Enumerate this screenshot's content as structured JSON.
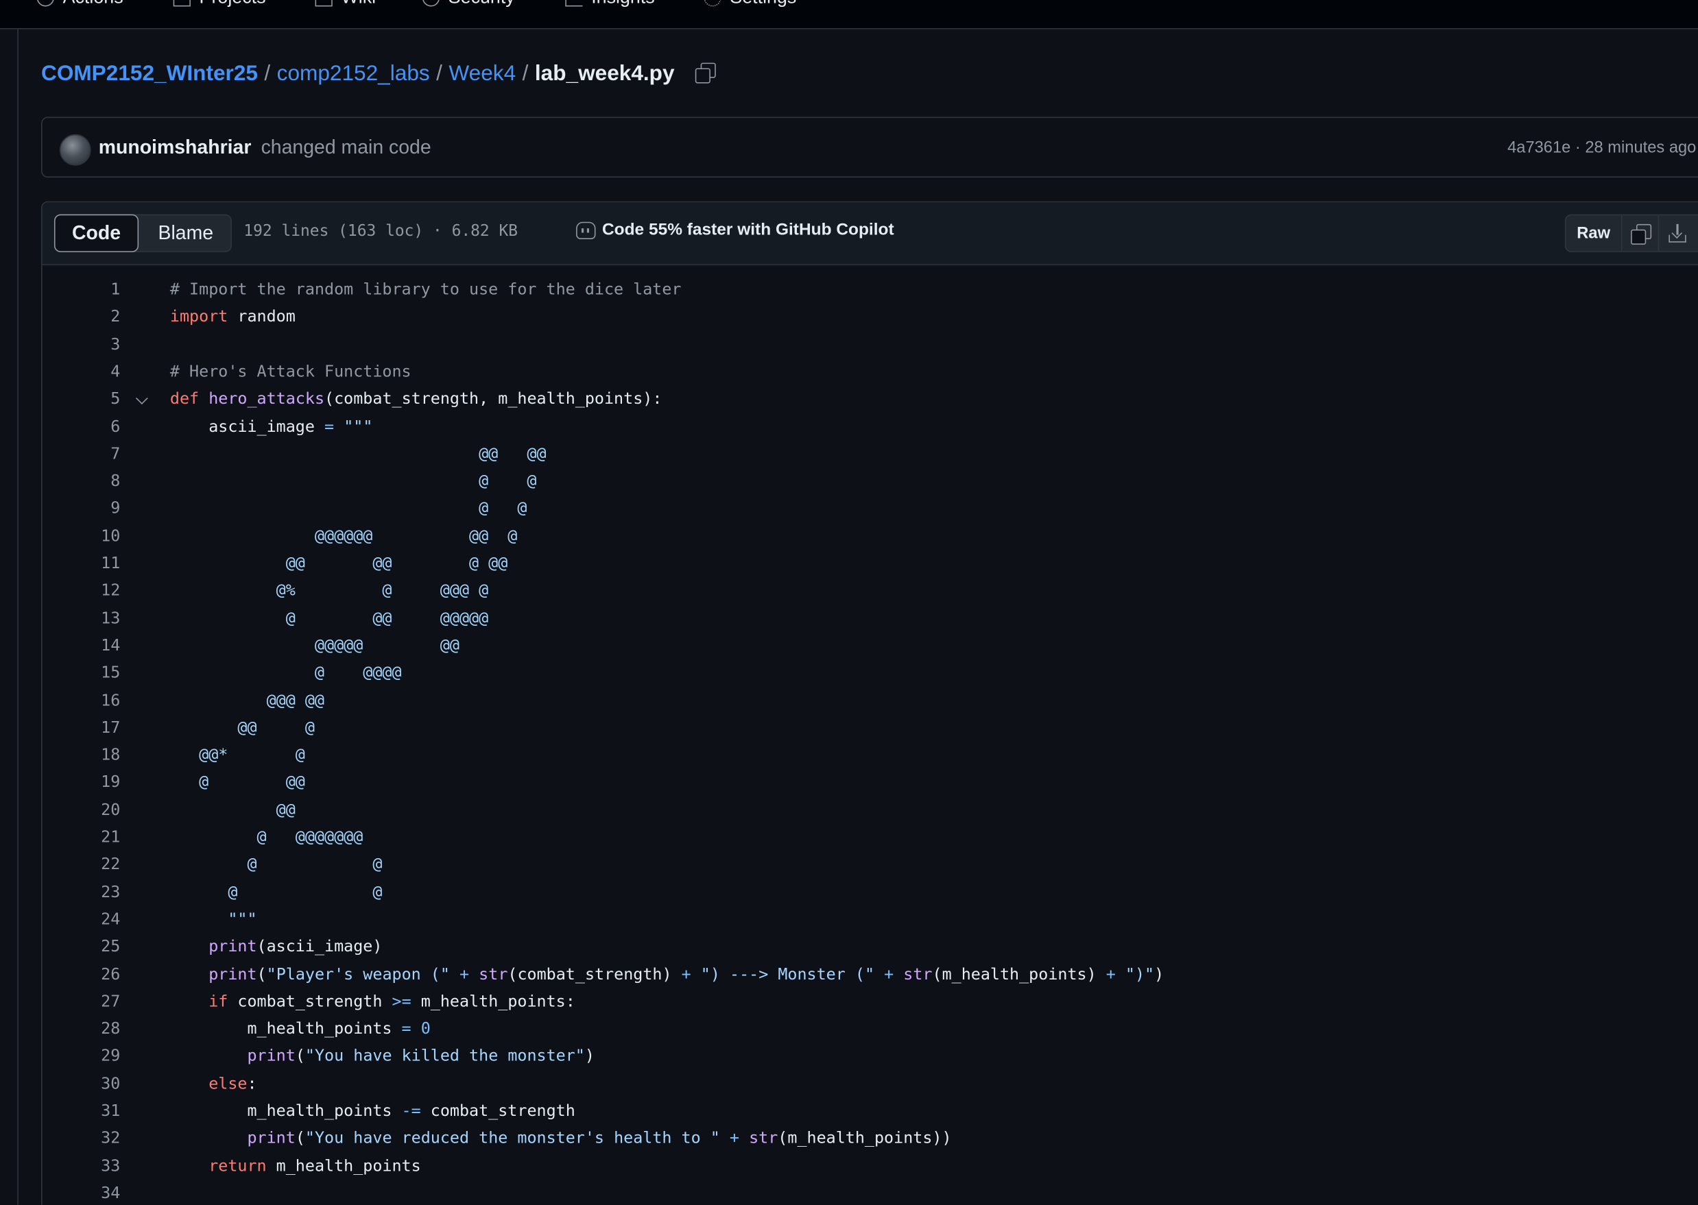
{
  "nav": {
    "items": [
      "Actions",
      "Projects",
      "Wiki",
      "Security",
      "Insights",
      "Settings"
    ]
  },
  "breadcrumb": {
    "owner": "COMP2152_WInter25",
    "repo": "comp2152_labs",
    "folder": "Week4",
    "file": "lab_week4.py",
    "separator": "/"
  },
  "commit": {
    "author": "munoimshahriar",
    "message": "changed main code",
    "meta": "4a7361e · 28 minutes ago"
  },
  "file_header": {
    "tab_code": "Code",
    "tab_blame": "Blame",
    "stats": "192 lines (163 loc) · 6.82 KB",
    "copilot": "Code 55% faster with GitHub Copilot",
    "raw": "Raw"
  },
  "code": {
    "visible_first_line": 1,
    "lines": [
      [
        [
          "c-com",
          "# Import the random library to use for the dice later"
        ]
      ],
      [
        [
          "c-kw",
          "import"
        ],
        [
          "",
          " random"
        ]
      ],
      [],
      [
        [
          "c-com",
          "# Hero's Attack Functions"
        ]
      ],
      [
        [
          "c-kw",
          "def"
        ],
        [
          "",
          " "
        ],
        [
          "c-fn",
          "hero_attacks"
        ],
        [
          "",
          "(combat_strength, m_health_points):"
        ]
      ],
      [
        [
          "",
          "    ascii_image "
        ],
        [
          "c-op",
          "="
        ],
        [
          "",
          " "
        ],
        [
          "c-str",
          "\"\"\""
        ]
      ],
      [
        [
          "c-str",
          "                                @@   @@"
        ]
      ],
      [
        [
          "c-str",
          "                                @    @"
        ]
      ],
      [
        [
          "c-str",
          "                                @   @"
        ]
      ],
      [
        [
          "c-str",
          "               @@@@@@          @@  @"
        ]
      ],
      [
        [
          "c-str",
          "            @@       @@        @ @@"
        ]
      ],
      [
        [
          "c-str",
          "           @%         @     @@@ @"
        ]
      ],
      [
        [
          "c-str",
          "            @        @@     @@@@@"
        ]
      ],
      [
        [
          "c-str",
          "               @@@@@        @@"
        ]
      ],
      [
        [
          "c-str",
          "               @    @@@@"
        ]
      ],
      [
        [
          "c-str",
          "          @@@ @@"
        ]
      ],
      [
        [
          "c-str",
          "       @@     @"
        ]
      ],
      [
        [
          "c-str",
          "   @@*       @"
        ]
      ],
      [
        [
          "c-str",
          "   @        @@"
        ]
      ],
      [
        [
          "c-str",
          "           @@"
        ]
      ],
      [
        [
          "c-str",
          "         @   @@@@@@@"
        ]
      ],
      [
        [
          "c-str",
          "        @            @"
        ]
      ],
      [
        [
          "c-str",
          "      @              @"
        ]
      ],
      [
        [
          "c-str",
          "      \"\"\""
        ]
      ],
      [
        [
          "",
          "    "
        ],
        [
          "c-fn",
          "print"
        ],
        [
          "",
          "(ascii_image)"
        ]
      ],
      [
        [
          "",
          "    "
        ],
        [
          "c-fn",
          "print"
        ],
        [
          "",
          "("
        ],
        [
          "c-str",
          "\"Player's weapon (\""
        ],
        [
          "",
          " "
        ],
        [
          "c-op",
          "+"
        ],
        [
          "",
          " "
        ],
        [
          "c-fn",
          "str"
        ],
        [
          "",
          "(combat_strength) "
        ],
        [
          "c-op",
          "+"
        ],
        [
          "",
          " "
        ],
        [
          "c-str",
          "\") ---> Monster (\""
        ],
        [
          "",
          " "
        ],
        [
          "c-op",
          "+"
        ],
        [
          "",
          " "
        ],
        [
          "c-fn",
          "str"
        ],
        [
          "",
          "(m_health_points) "
        ],
        [
          "c-op",
          "+"
        ],
        [
          "",
          " "
        ],
        [
          "c-str",
          "\")\""
        ],
        [
          "",
          ")"
        ]
      ],
      [
        [
          "",
          "    "
        ],
        [
          "c-kw",
          "if"
        ],
        [
          "",
          " combat_strength "
        ],
        [
          "c-op",
          ">="
        ],
        [
          "",
          " m_health_points:"
        ]
      ],
      [
        [
          "",
          "        m_health_points "
        ],
        [
          "c-op",
          "="
        ],
        [
          "",
          " "
        ],
        [
          "c-num",
          "0"
        ]
      ],
      [
        [
          "",
          "        "
        ],
        [
          "c-fn",
          "print"
        ],
        [
          "",
          "("
        ],
        [
          "c-str",
          "\"You have killed the monster\""
        ],
        [
          "",
          ")"
        ]
      ],
      [
        [
          "",
          "    "
        ],
        [
          "c-kw",
          "else"
        ],
        [
          "",
          ":"
        ]
      ],
      [
        [
          "",
          "        m_health_points "
        ],
        [
          "c-op",
          "-="
        ],
        [
          "",
          " combat_strength"
        ]
      ],
      [
        [
          "",
          "        "
        ],
        [
          "c-fn",
          "print"
        ],
        [
          "",
          "("
        ],
        [
          "c-str",
          "\"You have reduced the monster's health to \""
        ],
        [
          "",
          " "
        ],
        [
          "c-op",
          "+"
        ],
        [
          "",
          " "
        ],
        [
          "c-fn",
          "str"
        ],
        [
          "",
          "(m_health_points))"
        ]
      ],
      [
        [
          "",
          "    "
        ],
        [
          "c-kw",
          "return"
        ],
        [
          "",
          " m_health_points"
        ]
      ],
      []
    ]
  }
}
